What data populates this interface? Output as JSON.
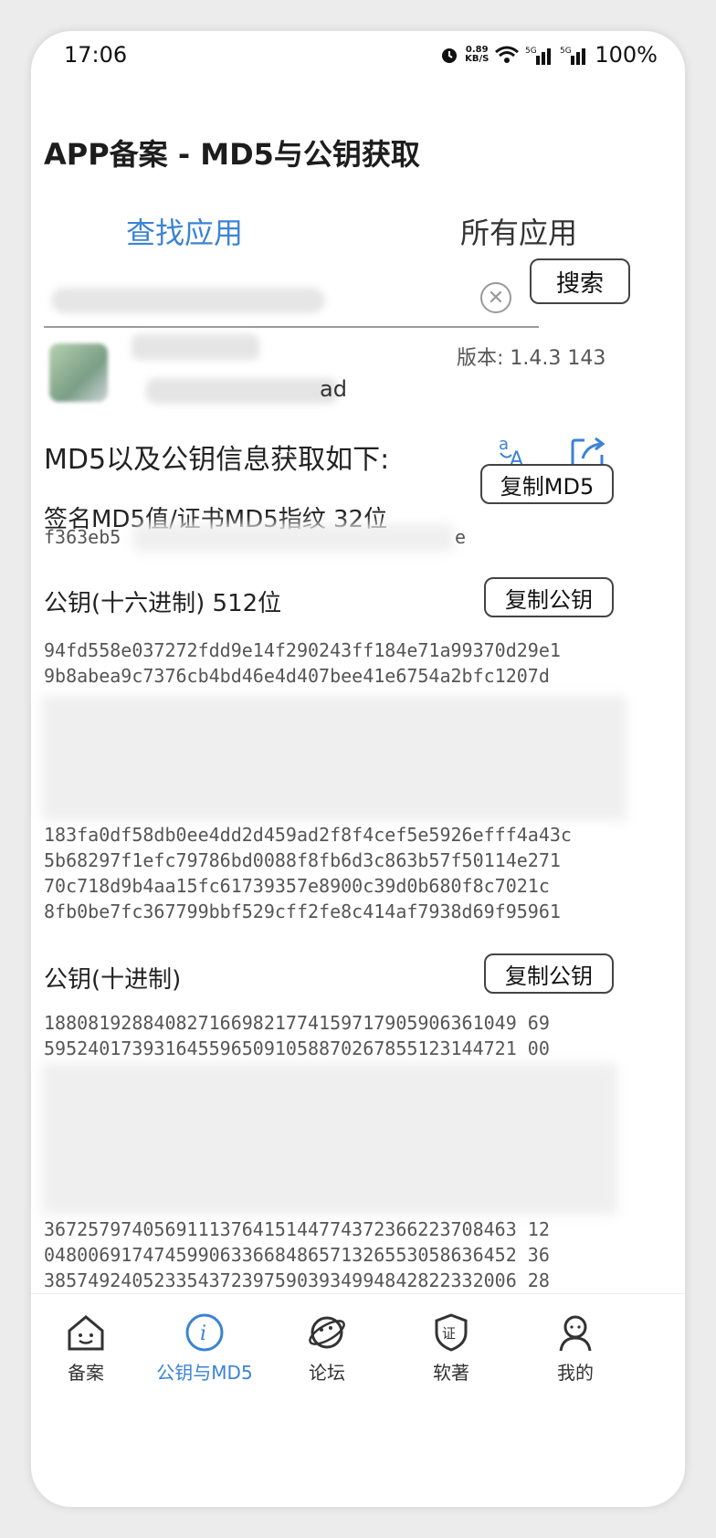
{
  "status": {
    "time": "17:06",
    "net_speed": "0.89",
    "net_unit": "KB/S",
    "battery": "100%",
    "sim1": "5G",
    "sim2": "5G"
  },
  "header": {
    "title": "APP备案 - MD5与公钥获取"
  },
  "tabs": [
    {
      "label": "查找应用",
      "active": true
    },
    {
      "label": "所有应用",
      "active": false
    }
  ],
  "search": {
    "value": "",
    "button_label": "搜索",
    "clear_glyph": "✕"
  },
  "app": {
    "version": "版本: 1.4.3   143",
    "package_suffix": "ad"
  },
  "result": {
    "title": "MD5以及公钥信息获取如下:",
    "translate_icon": "translate-icon",
    "share_icon": "share-icon"
  },
  "md5": {
    "label": "签名MD5值/证书MD5指纹   32位",
    "copy_label": "复制MD5",
    "value_prefix": "f363eb5",
    "value_suffix": "e"
  },
  "hex_key": {
    "label": "公钥(十六进制)   512位",
    "copy_label": "复制公钥",
    "lines_top": [
      "94fd558e037272fdd9e14f290243ff184e71a99370d29e1",
      "9b8abea9c7376cb4bd46e4d407bee41e6754a2bfc1207d"
    ],
    "lines_bottom": [
      "183fa0df58db0ee4dd2d459ad2f8f4cef5e5926efff4a43c",
      "5b68297f1efc79786bd0088f8fb6d3c863b57f50114e271",
      "70c718d9b4aa15fc61739357e8900c39d0b680f8c7021c",
      "8fb0be7fc367799bbf529cff2fe8c414af7938d69f95961"
    ]
  },
  "dec_key": {
    "label": "公钥(十进制)",
    "copy_label": "复制公钥",
    "lines_top": [
      "1880819288408271669821774159717905906361049 69",
      "5952401739316455965091058870267855123144721 00"
    ],
    "lines_bottom": [
      "3672579740569111376415144774372366223708463 12",
      "0480069174745990633668486571326553058636452 36",
      "3857492405233543723975903934994842822332006 28"
    ]
  },
  "nav": [
    {
      "label": "备案",
      "icon": "house-face-icon",
      "active": false
    },
    {
      "label": "公钥与MD5",
      "icon": "info-icon",
      "active": true
    },
    {
      "label": "论坛",
      "icon": "planet-icon",
      "active": false
    },
    {
      "label": "软著",
      "icon": "shield-cert-icon",
      "active": false
    },
    {
      "label": "我的",
      "icon": "person-icon",
      "active": false
    }
  ],
  "colors": {
    "accent": "#3b83d6",
    "text": "#222222",
    "muted": "#555555"
  }
}
